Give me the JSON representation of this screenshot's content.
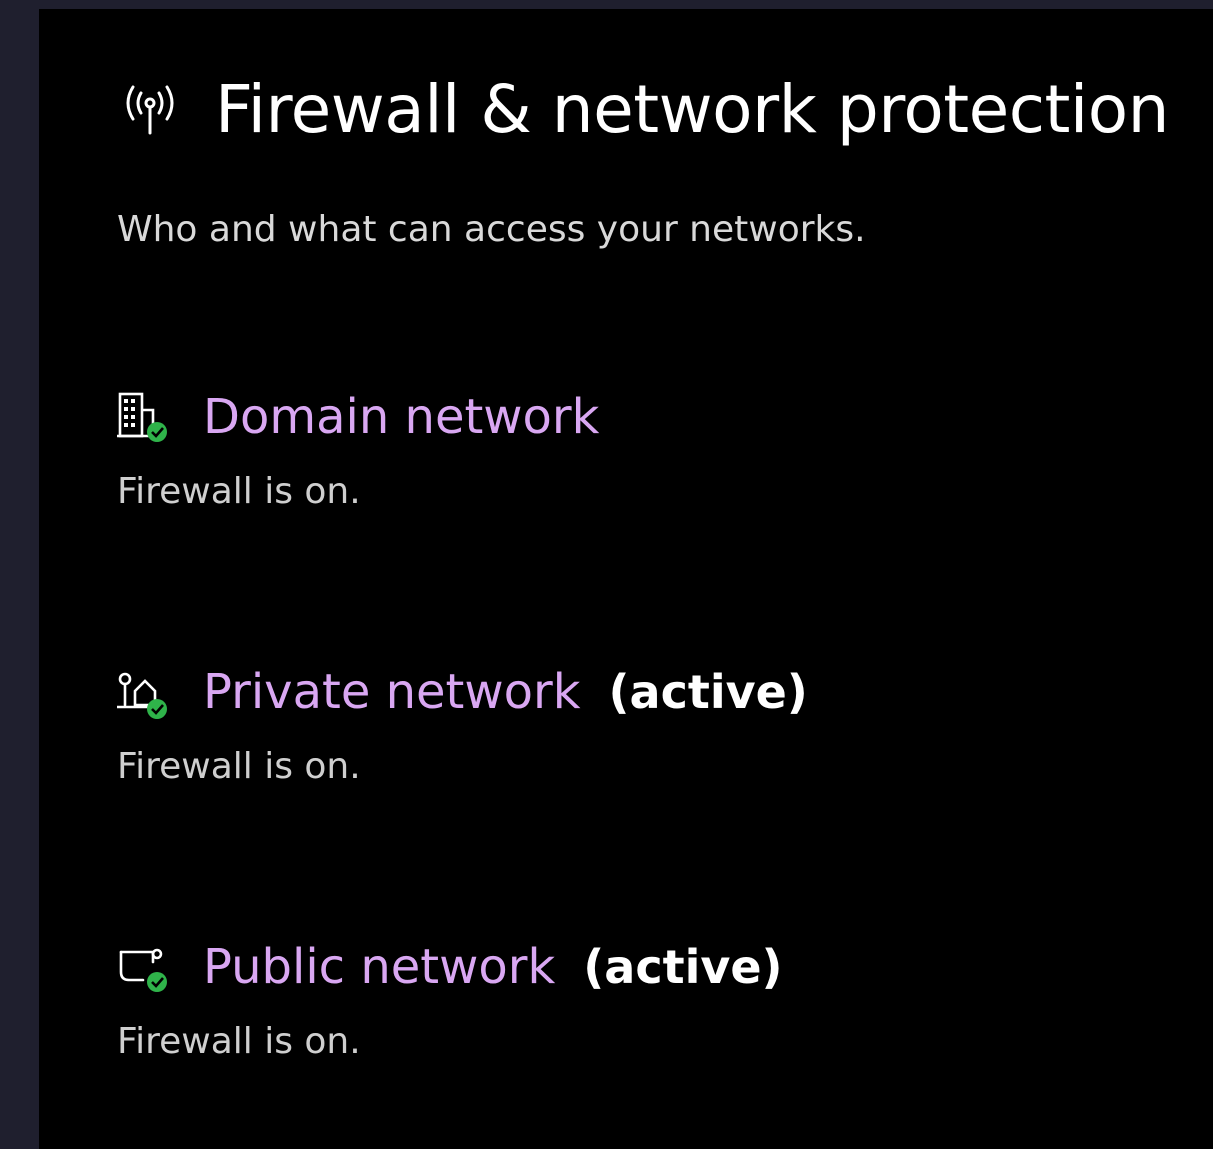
{
  "header": {
    "icon": "antenna-icon",
    "title": "Firewall & network protection",
    "subtitle": "Who and what can access your networks."
  },
  "networks": [
    {
      "name": "Domain network",
      "active_label": "",
      "status": "Firewall is on.",
      "icon": "domain-network-icon"
    },
    {
      "name": "Private network",
      "active_label": "(active)",
      "status": "Firewall is on.",
      "icon": "private-network-icon"
    },
    {
      "name": "Public network",
      "active_label": "(active)",
      "status": "Firewall is on.",
      "icon": "public-network-icon"
    }
  ],
  "colors": {
    "link": "#d9a7f2",
    "check": "#2fb34a",
    "background": "#000000"
  }
}
